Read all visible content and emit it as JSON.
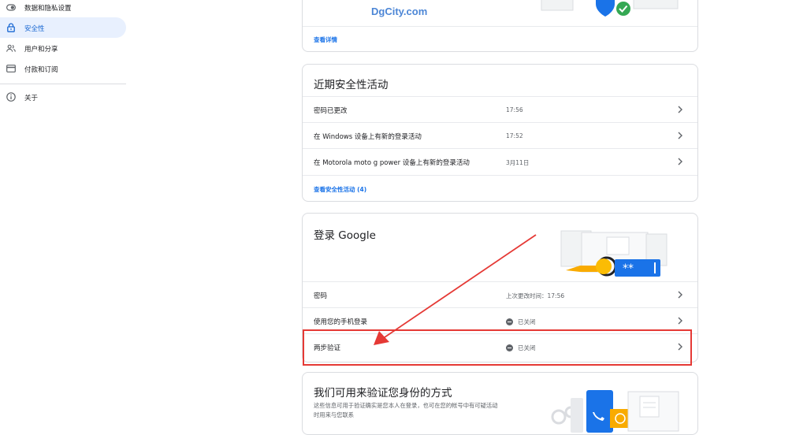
{
  "sidebar": {
    "items": [
      {
        "label": "数据和隐私设置",
        "icon": "toggle-icon"
      },
      {
        "label": "安全性",
        "icon": "lock-icon"
      },
      {
        "label": "用户和分享",
        "icon": "people-icon"
      },
      {
        "label": "付款和订阅",
        "icon": "credit-card-icon"
      },
      {
        "label": "关于",
        "icon": "info-icon"
      }
    ],
    "active": "安全性"
  },
  "watermark": "DgCity.com",
  "top_card": {
    "link": "查看详情"
  },
  "recent_activity": {
    "title": "近期安全性活动",
    "rows": [
      {
        "label": "密码已更改",
        "time": "17:56"
      },
      {
        "label": "在 Windows 设备上有新的登录活动",
        "time": "17:52"
      },
      {
        "label": "在 Motorola moto g power 设备上有新的登录活动",
        "time": "3月11日"
      }
    ],
    "link": "查看安全性活动 (4)"
  },
  "signin": {
    "title": "登录 Google",
    "rows": [
      {
        "label": "密码",
        "value": "上次更改时间：17:56"
      },
      {
        "label": "使用您的手机登录",
        "value": "已关闭"
      },
      {
        "label": "两步验证",
        "value": "已关闭"
      }
    ]
  },
  "verify": {
    "title": "我们可用来验证您身份的方式",
    "desc_line1": "这些信息可用于验证确实是您本人在登录，也可在您的帐号中有可疑活动",
    "desc_line2": "时用来与您联系"
  },
  "colors": {
    "accent": "#1a73e8",
    "active_bg": "#e8f0fe",
    "annotation_red": "#e53935"
  }
}
